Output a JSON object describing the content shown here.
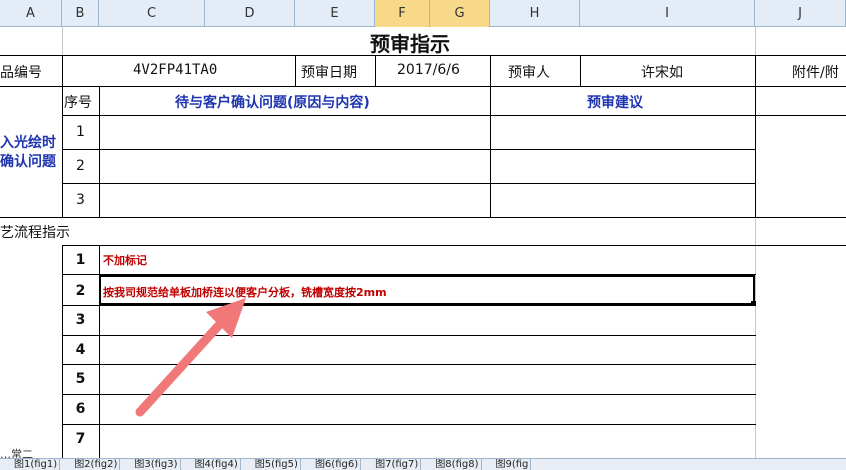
{
  "columns": [
    "A",
    "B",
    "C",
    "D",
    "E",
    "F",
    "G",
    "H",
    "I",
    "J"
  ],
  "selected_columns": [
    "F",
    "G"
  ],
  "title": "预审指示",
  "info_row": {
    "label1": "品编号",
    "value1": "4V2FP41TA0",
    "label2": "预审日期",
    "value2": "2017/6/6",
    "label3": "预审人",
    "value3": "许宋如",
    "label4": "附件/附"
  },
  "question_table": {
    "side_label": [
      "入光绘时",
      "确认问题"
    ],
    "seq_header": "序号",
    "question_header": "待与客户确认问题(原因与内容)",
    "advice_header": "预审建议",
    "rows": [
      "1",
      "2",
      "3"
    ]
  },
  "process_section": {
    "label": "艺流程指示",
    "rows": [
      {
        "num": "1",
        "text": "不加标记"
      },
      {
        "num": "2",
        "text": "按我司规范给单板加桥连以便客户分板，铣槽宽度按2mm"
      },
      {
        "num": "3",
        "text": ""
      },
      {
        "num": "4",
        "text": ""
      },
      {
        "num": "5",
        "text": ""
      },
      {
        "num": "6",
        "text": ""
      },
      {
        "num": "7",
        "text": ""
      }
    ]
  },
  "bottom_cut_label": "…常二",
  "sheet_tabs": [
    "图1(fig1)",
    "图2(fig2)",
    "图3(fig3)",
    "图4(fig4)",
    "图5(fig5)",
    "图6(fig6)",
    "图7(fig7)",
    "图8(fig8)",
    "图9(fig"
  ],
  "colors": {
    "arrow": "#f07878",
    "title_blue": "#1f35b0",
    "note_red": "#c00000",
    "col_select": "#f8d98a"
  }
}
